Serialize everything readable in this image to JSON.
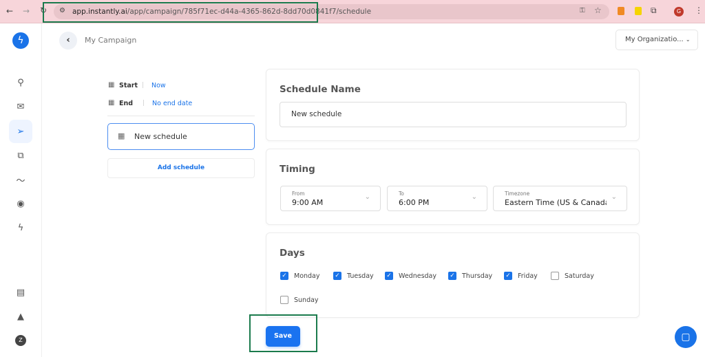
{
  "browser": {
    "url_host": "app.instantly.ai",
    "url_path": "/app/campaign/785f71ec-d44a-4365-862d-8dd70d0841f7/schedule",
    "profile_initial": "G"
  },
  "header": {
    "title": "My Campaign",
    "org_dropdown": "My Organizatio..."
  },
  "sidebar": {
    "items": [
      "search",
      "mail",
      "campaigns",
      "templates",
      "analytics",
      "contacts",
      "automations"
    ],
    "active": "campaigns",
    "avatar_initial": "Z"
  },
  "left": {
    "start_label": "Start",
    "start_value": "Now",
    "end_label": "End",
    "end_value": "No end date",
    "schedule_item": "New schedule",
    "add_schedule": "Add schedule"
  },
  "schedule_name": {
    "title": "Schedule Name",
    "value": "New schedule"
  },
  "timing": {
    "title": "Timing",
    "from_label": "From",
    "from_value": "9:00 AM",
    "to_label": "To",
    "to_value": "6:00 PM",
    "tz_label": "Timezone",
    "tz_value": "Eastern Time (US & Canada) ("
  },
  "days": {
    "title": "Days",
    "items": [
      {
        "label": "Monday",
        "checked": true
      },
      {
        "label": "Tuesday",
        "checked": true
      },
      {
        "label": "Wednesday",
        "checked": true
      },
      {
        "label": "Thursday",
        "checked": true
      },
      {
        "label": "Friday",
        "checked": true
      },
      {
        "label": "Saturday",
        "checked": false
      },
      {
        "label": "Sunday",
        "checked": false
      }
    ]
  },
  "save_label": "Save",
  "colors": {
    "accent": "#1a73e8",
    "annotation": "#1a7a4c"
  }
}
